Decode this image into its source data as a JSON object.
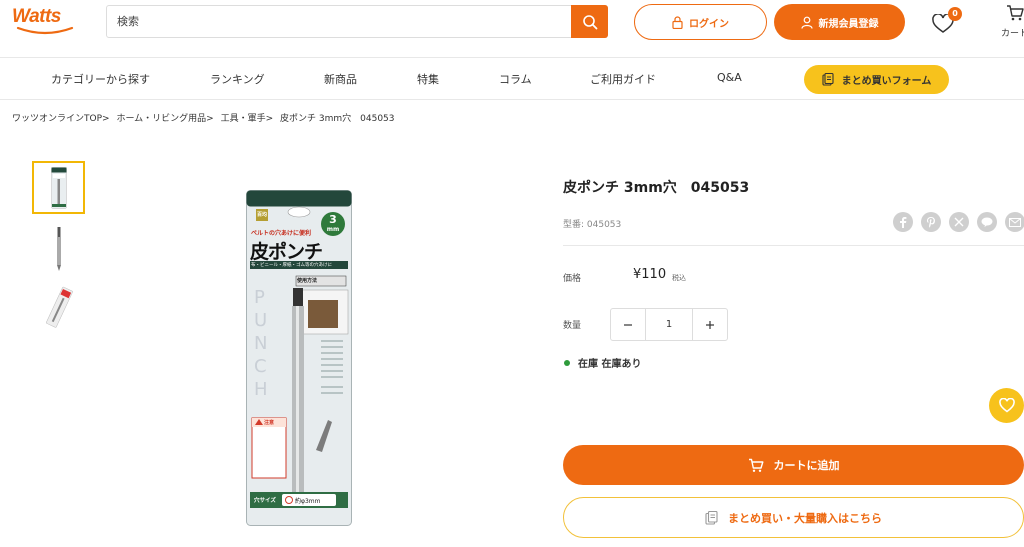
{
  "header": {
    "logo_text": "Watts",
    "search": {
      "placeholder": "検索"
    },
    "login_label": "ログイン",
    "register_label": "新規会員登録",
    "favorites_count": "0",
    "cart_label": "カート"
  },
  "nav": {
    "items": [
      "カテゴリーから探す",
      "ランキング",
      "新商品",
      "特集",
      "コラム",
      "ご利用ガイド",
      "Q&A"
    ],
    "bulk_form_label": "まとめ買いフォーム"
  },
  "breadcrumb": [
    "ワッツオンラインTOP>",
    "ホーム・リビング用品>",
    "工具・軍手>",
    "皮ポンチ 3mm穴　045053"
  ],
  "product": {
    "title": "皮ポンチ 3mm穴　045053",
    "sku": "型番: 045053",
    "price_label": "価格",
    "price": "¥110",
    "tax_note": "税込",
    "quantity_label": "数量",
    "quantity": "1",
    "stock": "在庫 在庫あり",
    "package": {
      "brand_badge": "百均",
      "size_badge": "3",
      "size_unit": "mm",
      "tagline": "ベルトの穴あけに便利",
      "name": "皮ポンチ",
      "subline": "布・ビニール・厚紙・ゴム等の穴あけに",
      "usage_label": "使用方法",
      "vertical_text": "PUNCH",
      "caution": "注意",
      "hole_size_label": "穴サイズ",
      "hole_size_value": "約φ3mm"
    }
  },
  "share_icons": [
    "facebook-icon",
    "pinterest-icon",
    "x-icon",
    "line-icon",
    "email-icon"
  ],
  "buttons": {
    "add_to_cart": "カートに追加",
    "bulk_buy": "まとめ買い・大量購入はこちら"
  },
  "colors": {
    "accent": "#ee6a12",
    "yellow": "#f7c21c",
    "stock_green": "#2e9b3b"
  }
}
